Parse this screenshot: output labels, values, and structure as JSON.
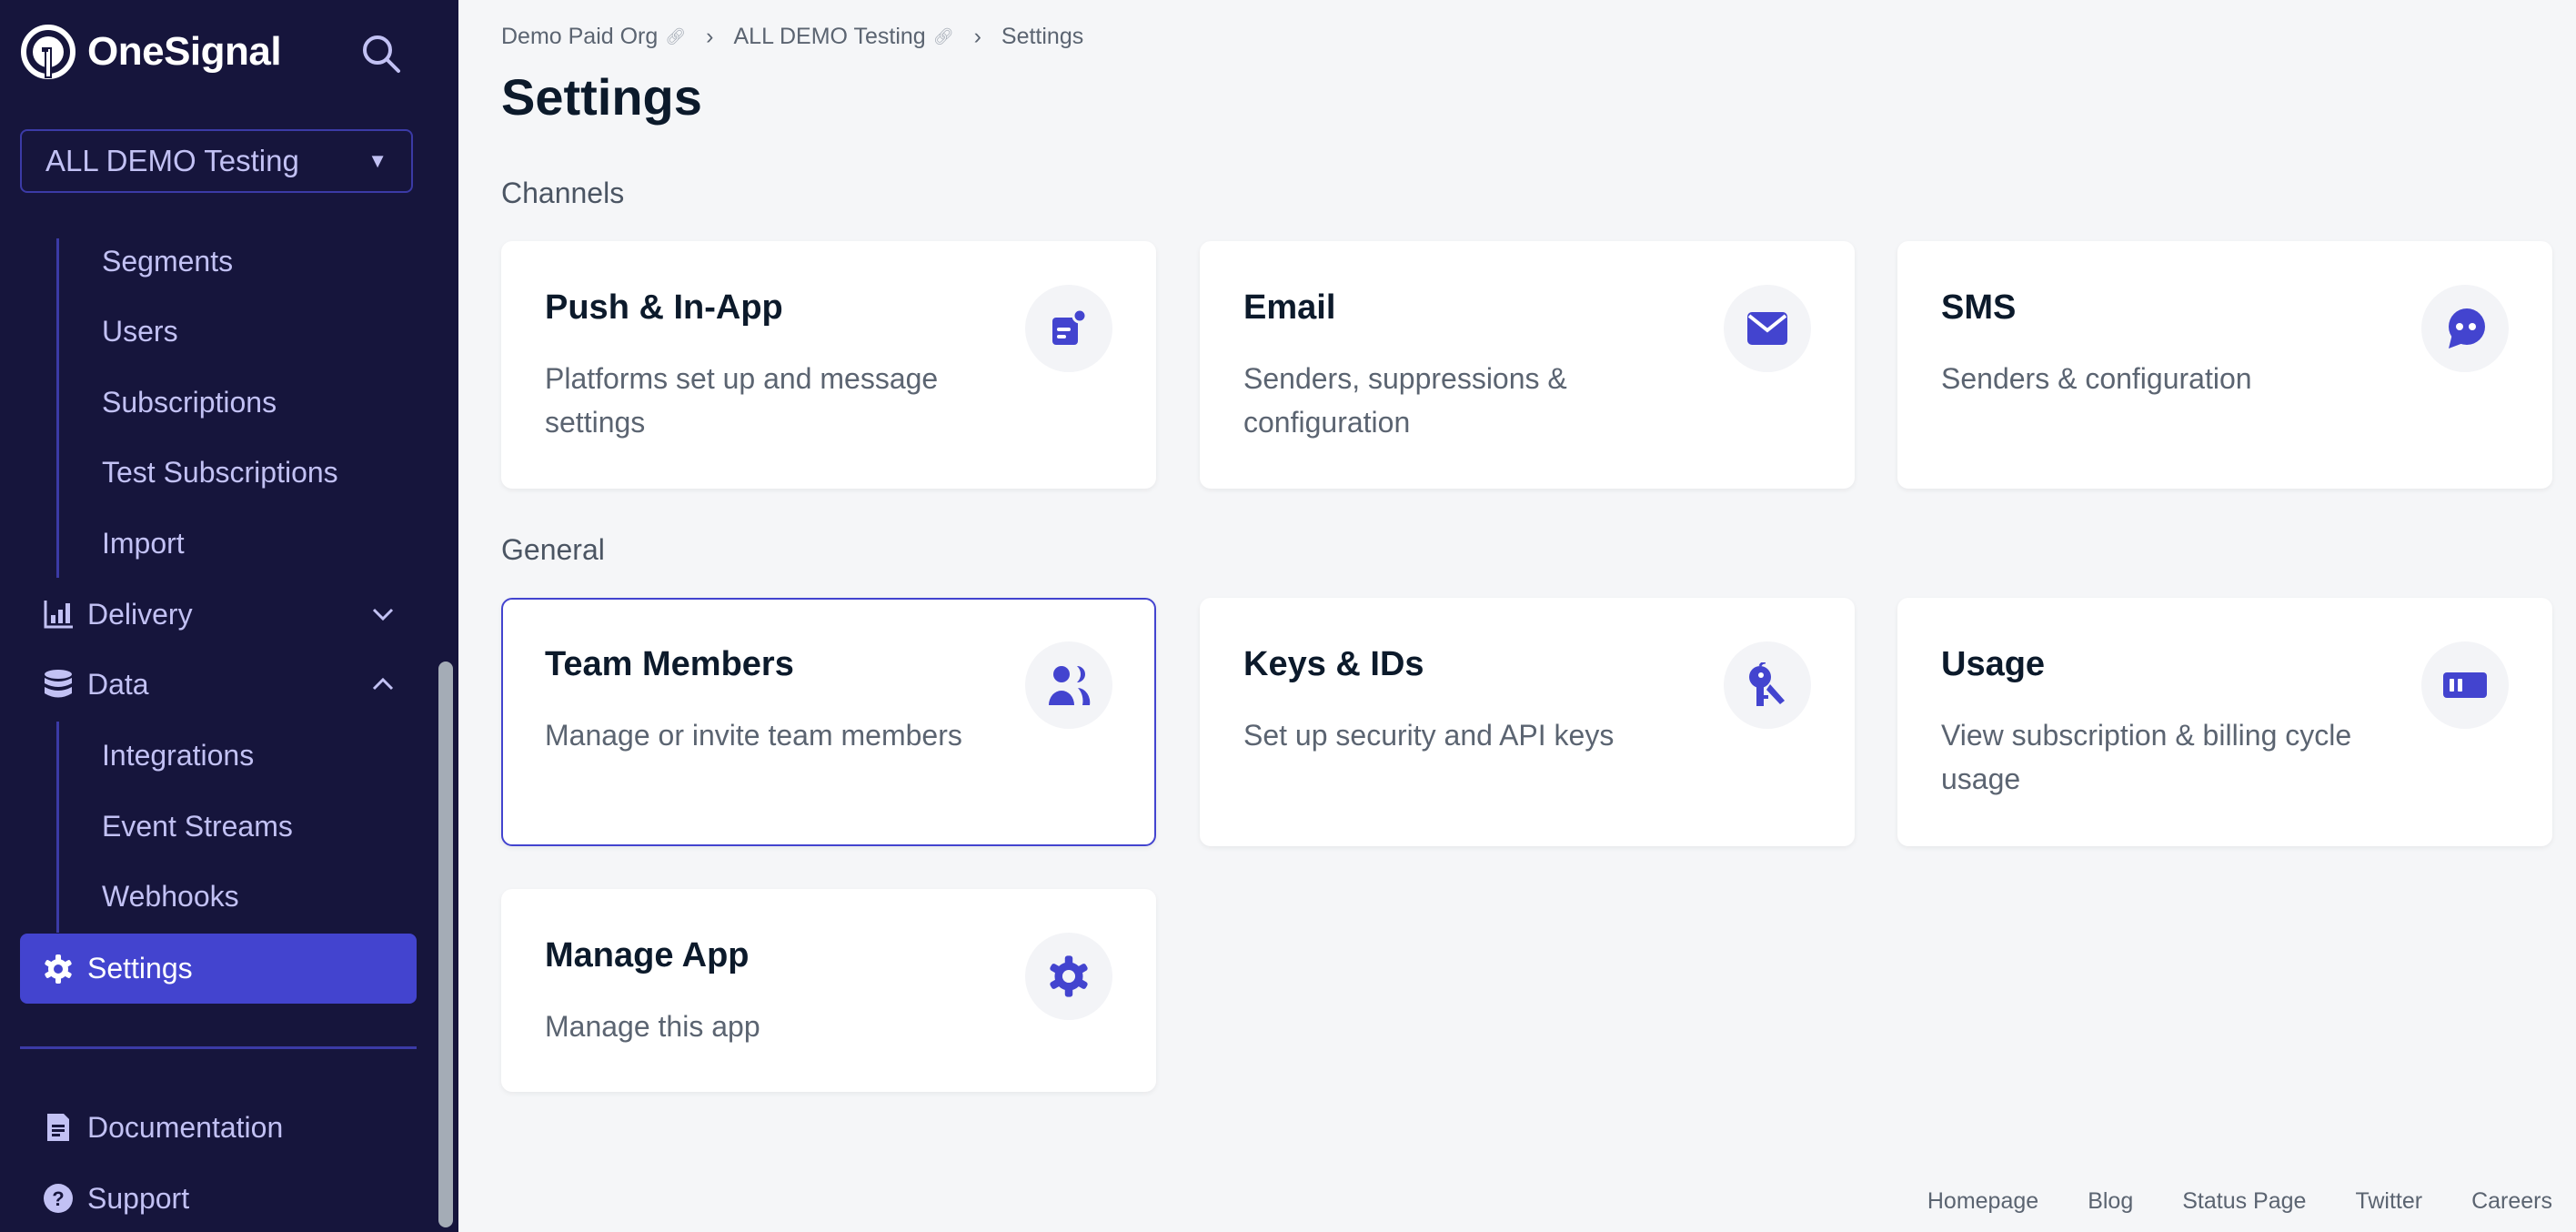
{
  "brand": {
    "name": "OneSignal",
    "accent": "#4344cf",
    "sidebar_bg": "#16153c"
  },
  "sidebar": {
    "app_selector": {
      "value": "ALL DEMO Testing"
    },
    "audience_sub_items": [
      "Segments",
      "Users",
      "Subscriptions",
      "Test Subscriptions",
      "Import"
    ],
    "delivery": {
      "label": "Delivery",
      "icon": "bar-chart-icon",
      "expanded": false
    },
    "data": {
      "label": "Data",
      "icon": "database-icon",
      "expanded": true
    },
    "data_sub_items": [
      "Integrations",
      "Event Streams",
      "Webhooks"
    ],
    "settings": {
      "label": "Settings",
      "icon": "gear-icon",
      "active": true
    },
    "documentation": {
      "label": "Documentation",
      "icon": "document-icon"
    },
    "support": {
      "label": "Support",
      "icon": "question-icon"
    }
  },
  "breadcrumb": {
    "items": [
      "Demo Paid Org",
      "ALL DEMO Testing",
      "Settings"
    ],
    "link_icon": "link-icon",
    "separator": "›"
  },
  "page": {
    "title": "Settings"
  },
  "sections": {
    "channels": {
      "label": "Channels",
      "cards": [
        {
          "title": "Push & In-App",
          "desc": "Platforms set up and message settings",
          "icon": "push-notification-icon"
        },
        {
          "title": "Email",
          "desc": "Senders, suppressions & configuration",
          "icon": "envelope-icon"
        },
        {
          "title": "SMS",
          "desc": "Senders & configuration",
          "icon": "chat-bubble-icon"
        }
      ]
    },
    "general": {
      "label": "General",
      "cards": [
        {
          "title": "Team Members",
          "desc": "Manage or invite team members",
          "icon": "users-icon"
        },
        {
          "title": "Keys & IDs",
          "desc": "Set up security and API keys",
          "icon": "keys-icon"
        },
        {
          "title": "Usage",
          "desc": "View subscription & billing cycle usage",
          "icon": "usage-meter-icon"
        },
        {
          "title": "Manage App",
          "desc": "Manage this app",
          "icon": "gear-icon"
        }
      ]
    }
  },
  "footer": {
    "links": [
      "Homepage",
      "Blog",
      "Status Page",
      "Twitter",
      "Careers"
    ]
  }
}
